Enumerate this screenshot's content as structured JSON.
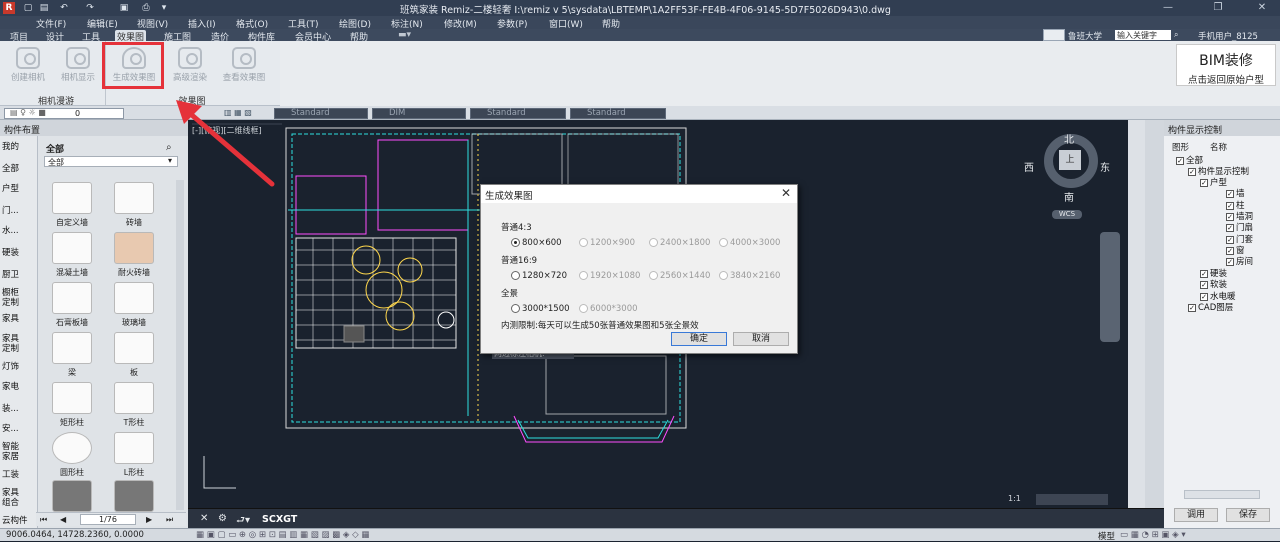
{
  "titlebar": {
    "title": "班筑家装 Remiz-二楼轻奢    I:\\remiz v 5\\sysdata\\LBTEMP\\1A2FF53F-FE4B-4F06-9145-5D7F5026D943\\0.dwg"
  },
  "menu": [
    "文件(F)",
    "编辑(E)",
    "视图(V)",
    "插入(I)",
    "格式(O)",
    "工具(T)",
    "绘图(D)",
    "标注(N)",
    "修改(M)",
    "参数(P)",
    "窗口(W)",
    "帮助"
  ],
  "tabs": [
    "项目",
    "设计",
    "工具",
    "效果图",
    "施工图",
    "造价",
    "构件库",
    "会员中心",
    "帮助"
  ],
  "top_right": {
    "school": "鲁班大学",
    "search_placeholder": "输入关键字",
    "user": "手机用户_8125"
  },
  "ribbon": {
    "buttons": [
      "创建相机",
      "相机显示",
      "生成效果图",
      "高级渲染",
      "查看效果图"
    ],
    "groups": [
      "相机漫游",
      "效果图"
    ]
  },
  "bim": {
    "title": "BIM装修",
    "subtitle": "点击返回原始户型"
  },
  "toolbar2": {
    "layer_value": "0",
    "styles": [
      "Standard",
      "DIM",
      "Standard",
      "Standard"
    ]
  },
  "left_panel": {
    "title": "构件布置",
    "categories": [
      "我的",
      "全部",
      "户型",
      "门...",
      "水...",
      "硬装",
      "厨卫",
      "橱柜定制",
      "家具",
      "家具定制",
      "灯饰",
      "家电",
      "装...",
      "安...",
      "智能家居",
      "工装",
      "家具组合",
      "云构件"
    ],
    "current": "全部",
    "filter": "全部",
    "components": [
      "自定义墙",
      "砖墙",
      "混凝土墙",
      "耐火砖墙",
      "石膏板墙",
      "玻璃墙",
      "梁",
      "板",
      "矩形柱",
      "T形柱",
      "圆形柱",
      "L形柱",
      "",
      ""
    ],
    "pager": "1/76"
  },
  "canvas": {
    "view_label": "[-][俯视][二维线框]",
    "compass": {
      "north": "北",
      "south": "南",
      "east": "东",
      "west": "西",
      "top": "上",
      "wcs": "WCS"
    },
    "hint": "两边标注相机:",
    "scale": "1:1"
  },
  "dialog": {
    "title": "生成效果图",
    "section1": "普通4:3",
    "opts1": [
      "800×600",
      "1200×900",
      "2400×1800",
      "4000×3000"
    ],
    "section2": "普通16:9",
    "opts2": [
      "1280×720",
      "1920×1080",
      "2560×1440",
      "3840×2160"
    ],
    "section3": "全景",
    "opts3": [
      "3000*1500",
      "6000*3000"
    ],
    "note": "内测限制:每天可以生成50张普通效果图和5张全景效",
    "ok": "确定",
    "cancel": "取消"
  },
  "command": {
    "text": "SCXGT"
  },
  "status": {
    "coords": "9006.0464,  14728.2360,  0.0000",
    "model": "模型"
  },
  "right_panel": {
    "title": "构件显示控制",
    "cols": [
      "图形",
      "名称"
    ],
    "tree": [
      "全部",
      "构件显示控制",
      "户型",
      "墙",
      "柱",
      "墙洞",
      "门扇",
      "门套",
      "窗",
      "房间",
      "硬装",
      "软装",
      "水电暖",
      "CAD图层"
    ],
    "apply": "调用",
    "save": "保存"
  },
  "colors": {
    "accent_red": "#e5323a",
    "canvas_bg": "#1a222e"
  }
}
